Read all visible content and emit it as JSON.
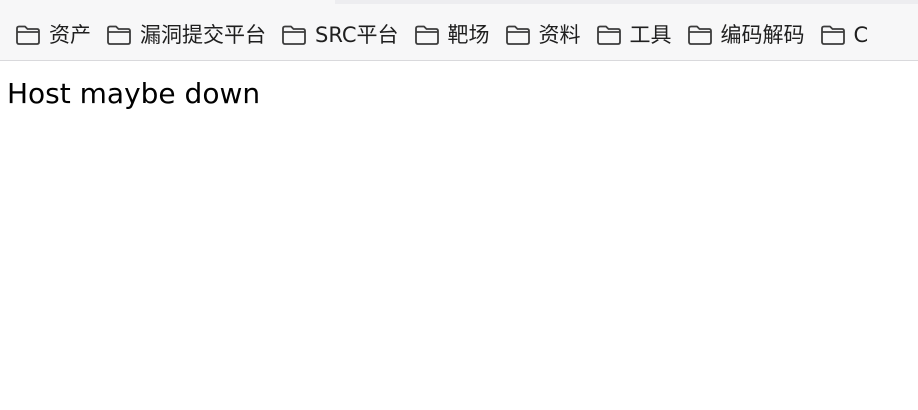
{
  "bookmarks": [
    {
      "label": "资产",
      "icon": "folder-icon"
    },
    {
      "label": "漏洞提交平台",
      "icon": "folder-icon"
    },
    {
      "label": "SRC平台",
      "icon": "folder-icon"
    },
    {
      "label": "靶场",
      "icon": "folder-icon"
    },
    {
      "label": "资料",
      "icon": "folder-icon"
    },
    {
      "label": "工具",
      "icon": "folder-icon"
    },
    {
      "label": "编码解码",
      "icon": "folder-icon"
    },
    {
      "label": "C",
      "icon": "folder-icon"
    }
  ],
  "page": {
    "message": "Host maybe down"
  },
  "colors": {
    "bar_background": "#f7f7f8",
    "page_background": "#ffffff",
    "text": "#1f1f1f"
  }
}
